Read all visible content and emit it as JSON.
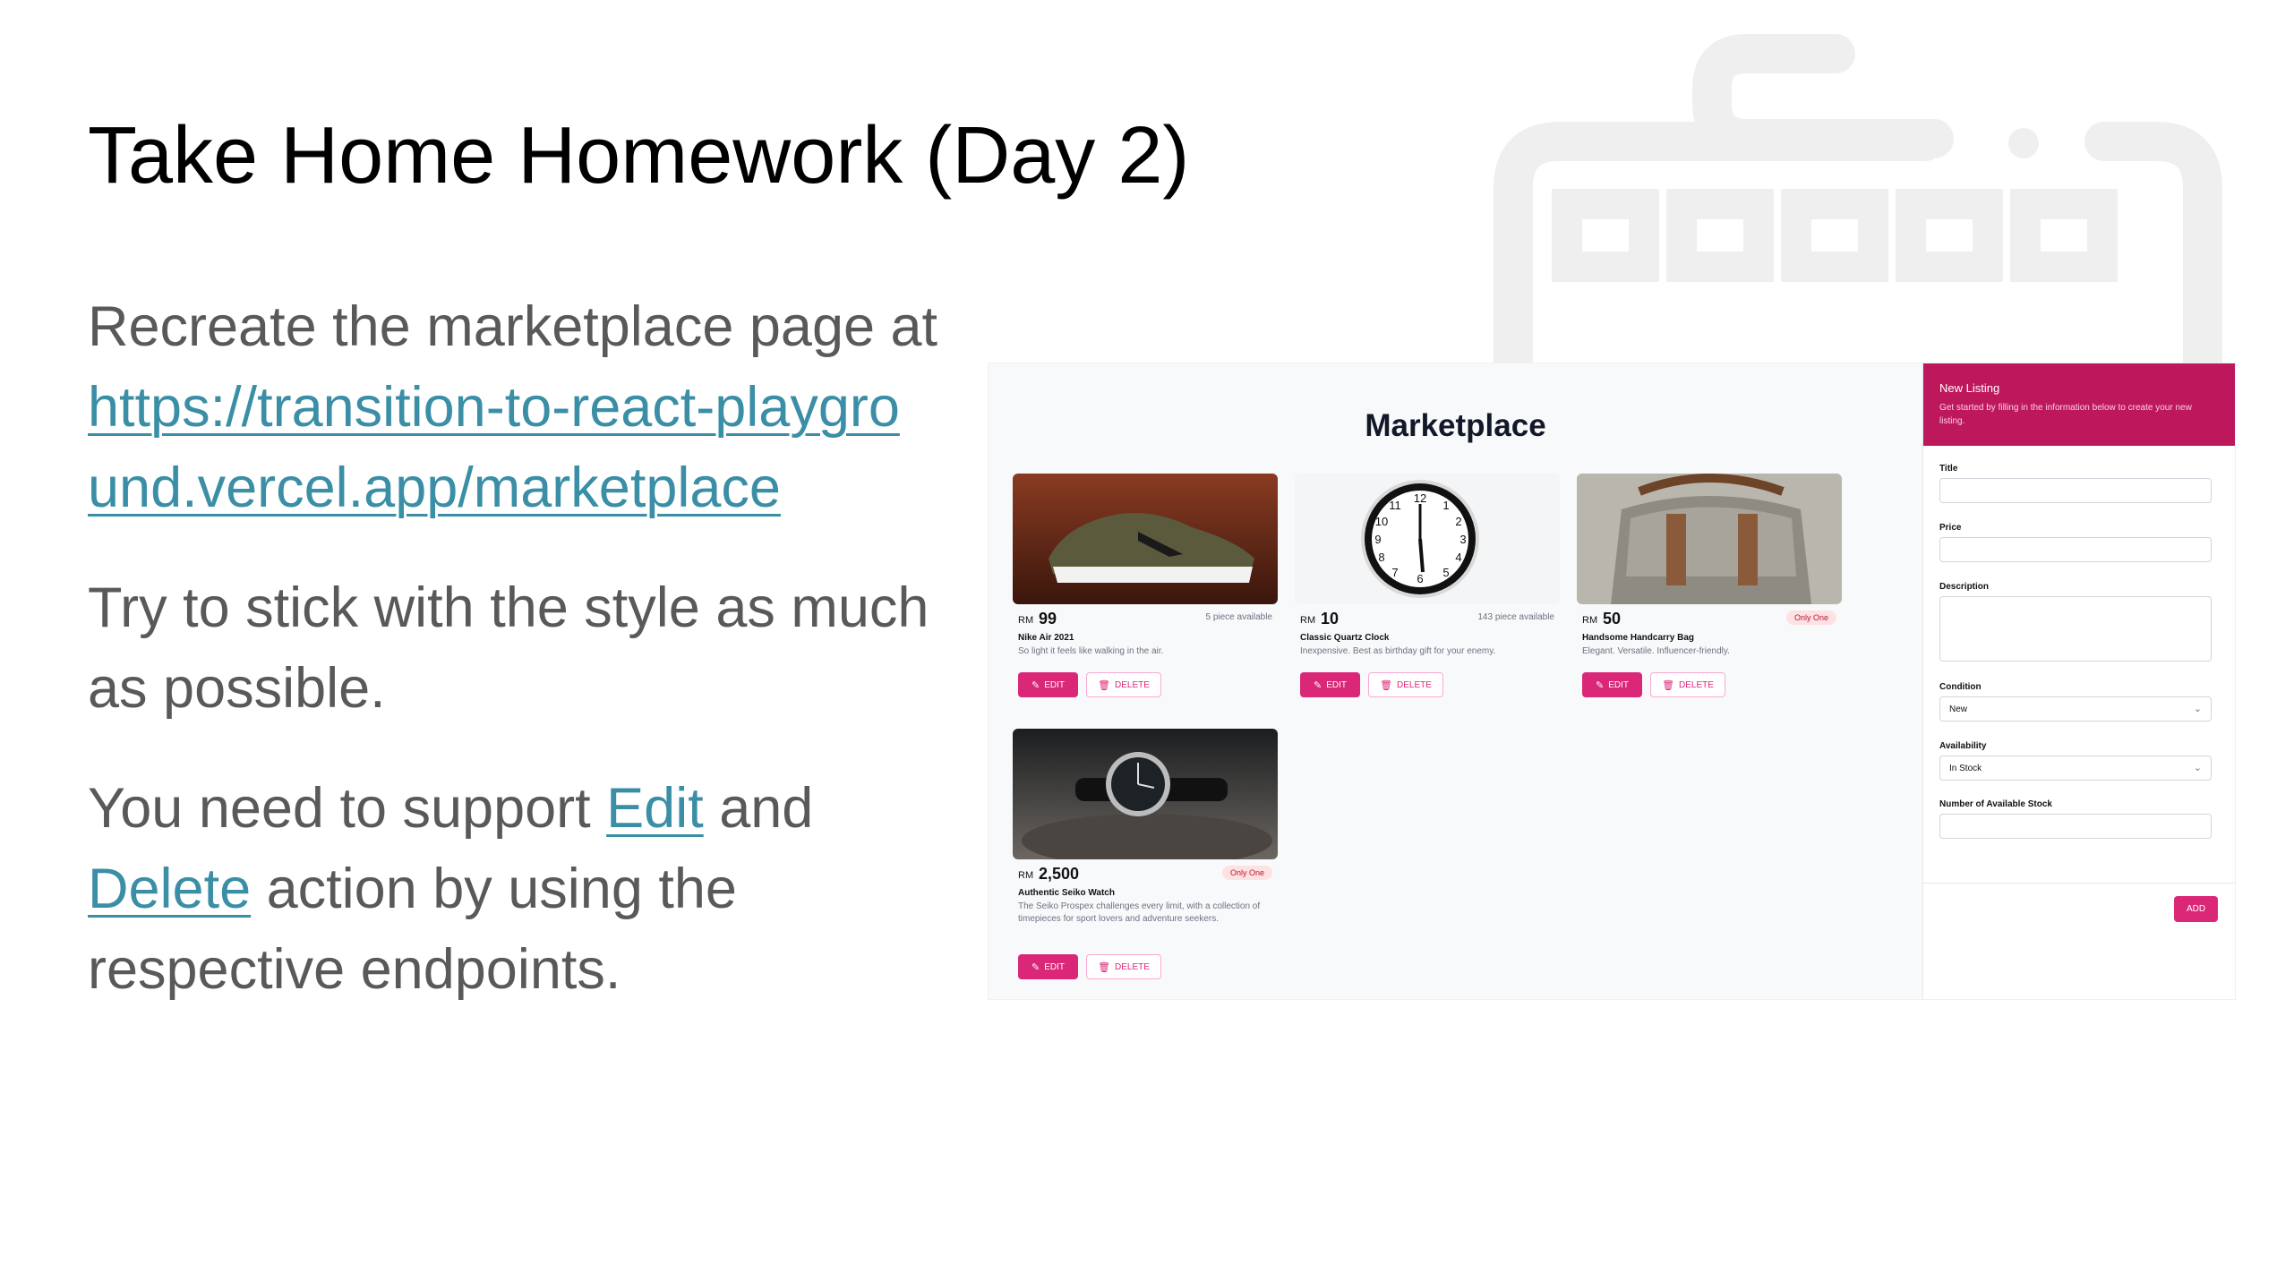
{
  "slide": {
    "title": "Take Home Homework (Day 2)",
    "para1_pre": "Recreate the marketplace page at",
    "url_line1": "https://transition-to-react-playgro",
    "url_line2": "und.vercel.app/marketplace",
    "para2": "Try to stick with the style as much as possible.",
    "para3_pre": "You need to support ",
    "edit_link": "Edit",
    "para3_mid": " and",
    "delete_link": "Delete",
    "para3_post": " action by using the respective endpoints."
  },
  "colors": {
    "link": "#3a8ea5",
    "accent": "#db2777",
    "header": "#be185d"
  },
  "marketplace": {
    "title": "Marketplace",
    "edit_label": "EDIT",
    "delete_label": "DELETE",
    "edit_icon": "pencil-icon",
    "delete_icon": "trash-icon",
    "listings": [
      {
        "currency": "RM",
        "price": "99",
        "availability": "5 piece available",
        "name": "Nike Air 2021",
        "description": "So light it feels like walking in the air.",
        "image": "sneaker"
      },
      {
        "currency": "RM",
        "price": "10",
        "availability": "143 piece available",
        "name": "Classic Quartz Clock",
        "description": "Inexpensive. Best as birthday gift for your enemy.",
        "image": "wall-clock"
      },
      {
        "currency": "RM",
        "price": "50",
        "badge": "Only One",
        "name": "Handsome Handcarry Bag",
        "description": "Elegant. Versatile. Influencer-friendly.",
        "image": "canvas-bag"
      },
      {
        "currency": "RM",
        "price": "2,500",
        "badge": "Only One",
        "name": "Authentic Seiko Watch",
        "description": "The Seiko Prospex challenges every limit, with a collection of timepieces for sport lovers and adventure seekers.",
        "image": "wristwatch"
      }
    ]
  },
  "form": {
    "title": "New Listing",
    "subtitle": "Get started by filling in the information below to create your new listing.",
    "title_label": "Title",
    "price_label": "Price",
    "description_label": "Description",
    "condition_label": "Condition",
    "condition_value": "New",
    "availability_label": "Availability",
    "availability_value": "In Stock",
    "stock_label": "Number of Available Stock",
    "add_label": "ADD"
  }
}
